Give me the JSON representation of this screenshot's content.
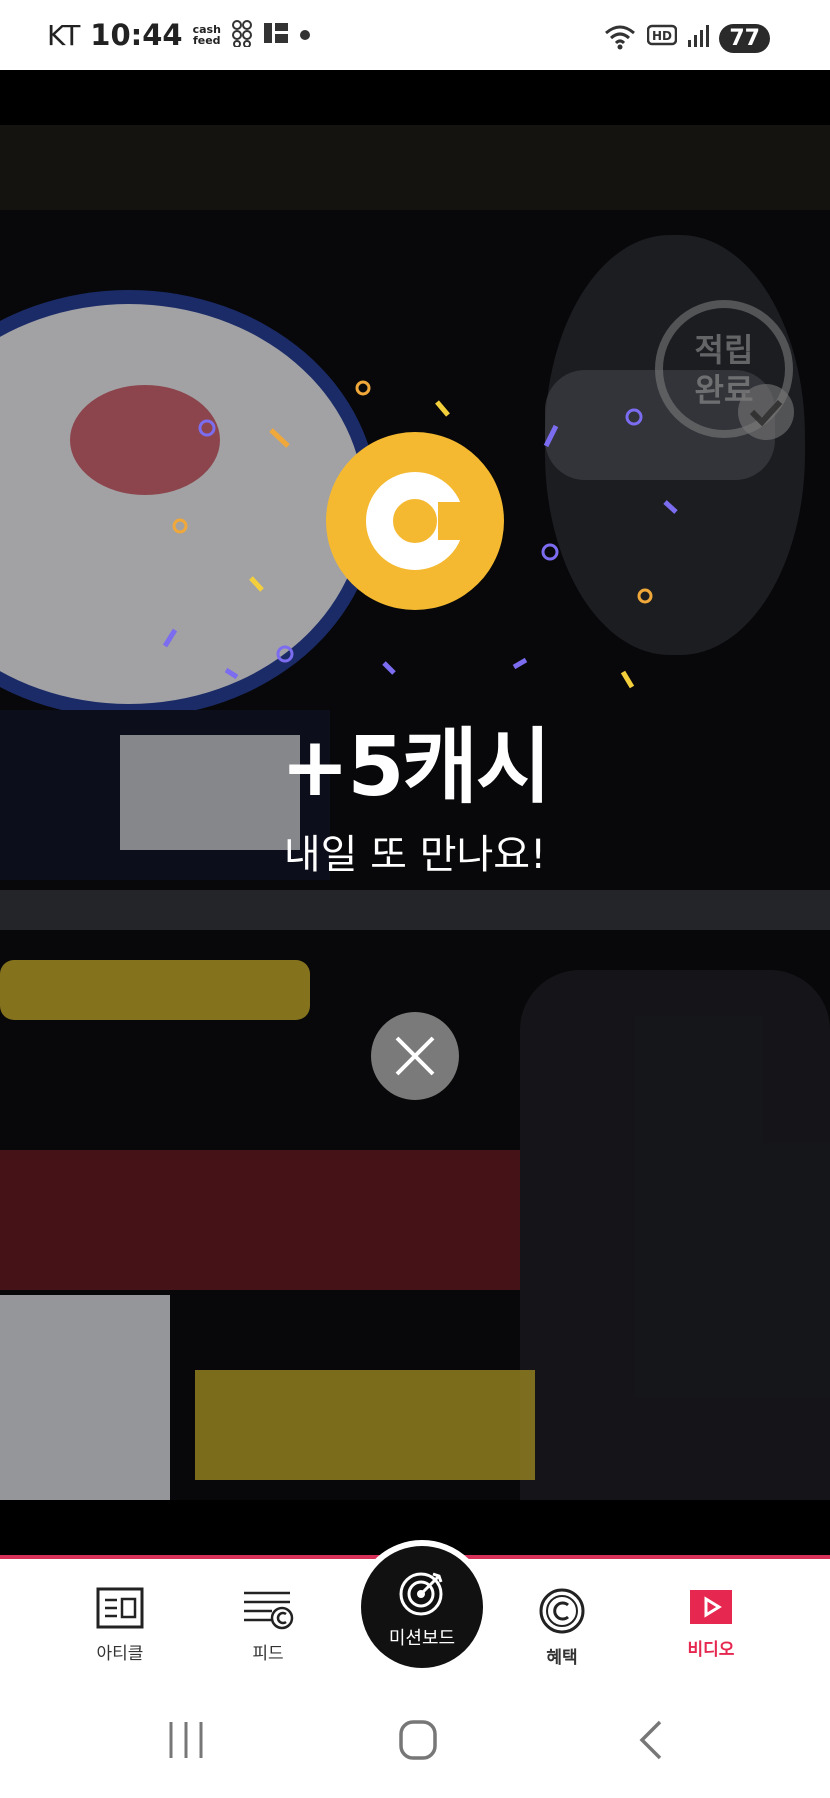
{
  "status_bar": {
    "carrier": "KT",
    "time": "10:44",
    "cashfeed_label_1": "cash",
    "cashfeed_label_2": "feed",
    "hd_label": "HD",
    "battery": "77"
  },
  "reward": {
    "amount": "+5캐시",
    "message": "내일 또 만나요!",
    "stamp_text": "적립\n완료",
    "coin_color": "#f4b930"
  },
  "tabs": [
    {
      "label": "아티클",
      "icon": "article-icon"
    },
    {
      "label": "피드",
      "icon": "feed-icon"
    },
    {
      "label": "미션보드",
      "icon": "target-icon"
    },
    {
      "label": "혜택",
      "icon": "cash-coin-icon"
    },
    {
      "label": "비디오",
      "icon": "play-icon",
      "active": true
    }
  ],
  "colors": {
    "accent": "#e6274f",
    "confetti_purple": "#7b6cf0",
    "confetti_yellow": "#f4cf3c",
    "confetti_orange": "#f0a83a"
  }
}
